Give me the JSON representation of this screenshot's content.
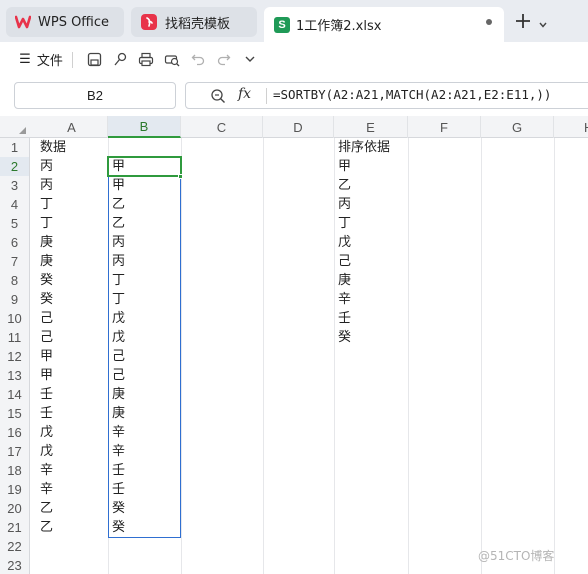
{
  "tabs": {
    "wps_label": "WPS Office",
    "docer_label": "找稻壳模板",
    "file_label": "1工作簿2.xlsx"
  },
  "colors": {
    "accent": "#2f9a3d",
    "selection": "#2f6fd1",
    "wps_red": "#e8334a",
    "sheet_green": "#1f9a57"
  },
  "toolbar": {
    "file_menu_label": "文件",
    "icons": [
      "save-icon",
      "clip-icon",
      "print-icon",
      "print-preview-icon",
      "undo-icon",
      "redo-icon",
      "chevron-down-icon"
    ]
  },
  "formula_bar": {
    "cell_ref": "B2",
    "fx_label": "fx",
    "formula": "=SORTBY(A2:A21,MATCH(A2:A21,E2:E11,))"
  },
  "columns": [
    "A",
    "B",
    "C",
    "D",
    "E",
    "F",
    "G",
    "H"
  ],
  "rows": [
    {
      "n": "1",
      "a": "数据",
      "b": "",
      "e": "排序依据"
    },
    {
      "n": "2",
      "a": "丙",
      "b": "甲",
      "e": "甲"
    },
    {
      "n": "3",
      "a": "丙",
      "b": "甲",
      "e": "乙"
    },
    {
      "n": "4",
      "a": "丁",
      "b": "乙",
      "e": "丙"
    },
    {
      "n": "5",
      "a": "丁",
      "b": "乙",
      "e": "丁"
    },
    {
      "n": "6",
      "a": "庚",
      "b": "丙",
      "e": "戊"
    },
    {
      "n": "7",
      "a": "庚",
      "b": "丙",
      "e": "己"
    },
    {
      "n": "8",
      "a": "癸",
      "b": "丁",
      "e": "庚"
    },
    {
      "n": "9",
      "a": "癸",
      "b": "丁",
      "e": "辛"
    },
    {
      "n": "10",
      "a": "己",
      "b": "戊",
      "e": "壬"
    },
    {
      "n": "11",
      "a": "己",
      "b": "戊",
      "e": "癸"
    },
    {
      "n": "12",
      "a": "甲",
      "b": "己",
      "e": ""
    },
    {
      "n": "13",
      "a": "甲",
      "b": "己",
      "e": ""
    },
    {
      "n": "14",
      "a": "壬",
      "b": "庚",
      "e": ""
    },
    {
      "n": "15",
      "a": "壬",
      "b": "庚",
      "e": ""
    },
    {
      "n": "16",
      "a": "戊",
      "b": "辛",
      "e": ""
    },
    {
      "n": "17",
      "a": "戊",
      "b": "辛",
      "e": ""
    },
    {
      "n": "18",
      "a": "辛",
      "b": "壬",
      "e": ""
    },
    {
      "n": "19",
      "a": "辛",
      "b": "壬",
      "e": ""
    },
    {
      "n": "20",
      "a": "乙",
      "b": "癸",
      "e": ""
    },
    {
      "n": "21",
      "a": "乙",
      "b": "癸",
      "e": ""
    },
    {
      "n": "22",
      "a": "",
      "b": "",
      "e": ""
    },
    {
      "n": "23",
      "a": "",
      "b": "",
      "e": ""
    }
  ],
  "active": {
    "column": "B",
    "row": "2"
  },
  "watermark": "@51CTO博客"
}
